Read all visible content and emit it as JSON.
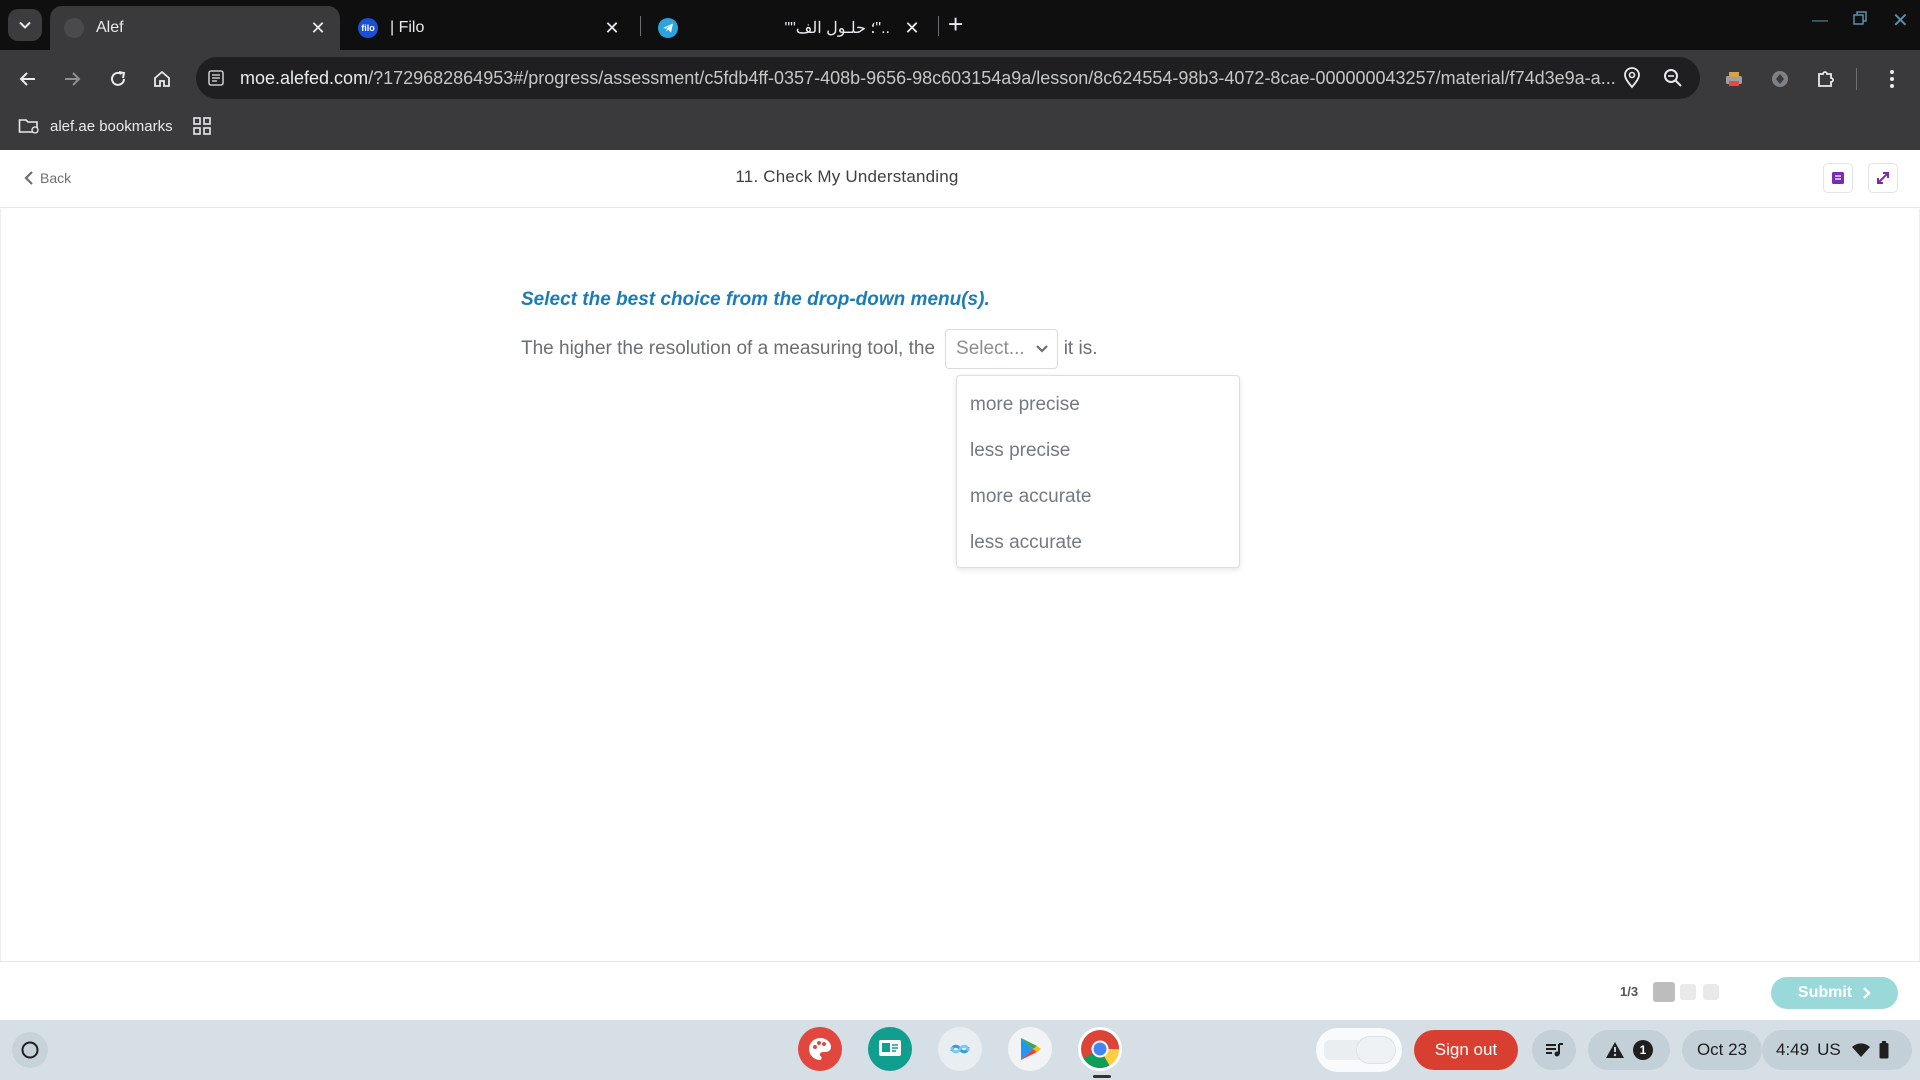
{
  "browser": {
    "tabs": [
      {
        "title": "Alef",
        "favicon": "alef-favicon"
      },
      {
        "title": "| Filo",
        "favicon_text": "filo"
      },
      {
        "title": "\"\"؛ حلـول الف\"..",
        "favicon": "telegram-icon"
      }
    ],
    "url_host": "moe.alefed.com",
    "url_path": "/?1729682864953#/progress/assessment/c5fdb4ff-0357-408b-9656-98c603154a9a/lesson/8c624554-98b3-4072-8cae-000000043257/material/f74d3e9a-a...",
    "bookmark_folder": "alef.ae bookmarks"
  },
  "page": {
    "back_label": "Back",
    "title": "11. Check My Understanding"
  },
  "question": {
    "instruction": "Select the best choice from the drop-down menu(s).",
    "text_before": "The higher the resolution of a measuring tool, the",
    "select_placeholder": "Select...",
    "text_after": "it is.",
    "options": [
      "more precise",
      "less precise",
      "more accurate",
      "less accurate"
    ]
  },
  "footer": {
    "counter": "1/3",
    "submit_label": "Submit"
  },
  "shelf": {
    "sign_out": "Sign out",
    "notification_count": "1",
    "date": "Oct 23",
    "time": "4:49",
    "locale": "US"
  },
  "colors": {
    "instruction": "#1d7cb4",
    "submit_bg": "#9ad9da",
    "sign_out_bg": "#d93f31"
  }
}
